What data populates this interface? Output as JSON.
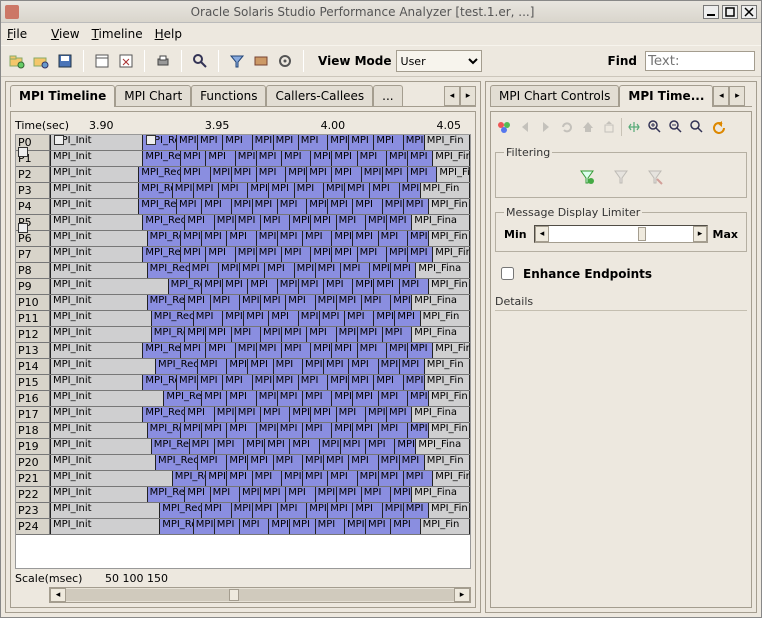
{
  "window": {
    "title": "Oracle Solaris Studio Performance Analyzer [test.1.er, ...]"
  },
  "menu": {
    "file": "File",
    "view": "View",
    "timeline": "Timeline",
    "help": "Help"
  },
  "toolbar": {
    "view_mode_label": "View Mode",
    "view_mode_value": "User",
    "find_label": "Find",
    "find_placeholder": "Text:",
    "find_value": ""
  },
  "left_tabs": {
    "items": [
      "MPI Timeline",
      "MPI Chart",
      "Functions",
      "Callers-Callees"
    ],
    "overflow": "...",
    "active": 0
  },
  "right_tabs": {
    "items": [
      "MPI Chart Controls",
      "MPI Time..."
    ],
    "active": 1
  },
  "time_axis": {
    "label": "Time(sec)",
    "ticks": [
      "3.90",
      "3.95",
      "4.00",
      "4.05"
    ]
  },
  "scale_axis": {
    "label": "Scale(msec)",
    "ticks": [
      "50",
      "100",
      "150"
    ]
  },
  "processes": [
    "P0",
    "P1",
    "P2",
    "P3",
    "P4",
    "P5",
    "P6",
    "P7",
    "P8",
    "P9",
    "P10",
    "P11",
    "P12",
    "P13",
    "P14",
    "P15",
    "P16",
    "P17",
    "P18",
    "P19",
    "P20",
    "P21",
    "P22",
    "P23",
    "P24"
  ],
  "segments": {
    "init": "MPI_Init",
    "recv_short": "MPI_R",
    "recv_mid": "MPI_Re",
    "recv_long": "MPI_Recv",
    "mpi": "MPI",
    "final": "MPI_Fina",
    "final_s": "MPI_Fin"
  },
  "controls": {
    "filtering_label": "Filtering",
    "msg_limiter_label": "Message Display Limiter",
    "min": "Min",
    "max": "Max",
    "enhance": "Enhance Endpoints",
    "details": "Details"
  }
}
